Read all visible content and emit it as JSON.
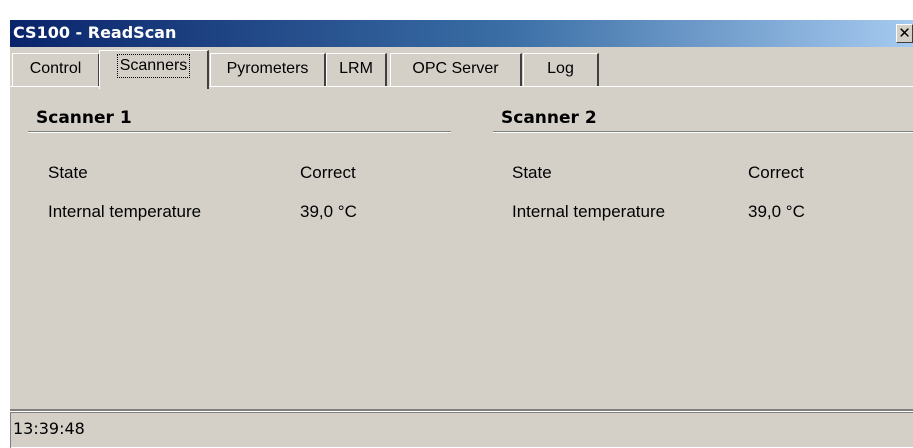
{
  "window": {
    "title": "CS100 - ReadScan",
    "close_glyph": "✕"
  },
  "tabs": [
    {
      "label": "Control"
    },
    {
      "label": "Scanners",
      "active": true
    },
    {
      "label": "Pyrometers"
    },
    {
      "label": "LRM"
    },
    {
      "label": "OPC Server"
    },
    {
      "label": "Log"
    }
  ],
  "scanners": [
    {
      "title": "Scanner 1",
      "rows": [
        {
          "label": "State",
          "value": "Correct"
        },
        {
          "label": "Internal temperature",
          "value": "39,0 °C"
        }
      ]
    },
    {
      "title": "Scanner 2",
      "rows": [
        {
          "label": "State",
          "value": "Correct"
        },
        {
          "label": "Internal temperature",
          "value": "39,0 °C"
        }
      ]
    }
  ],
  "statusbar": {
    "time": "13:39:48"
  }
}
